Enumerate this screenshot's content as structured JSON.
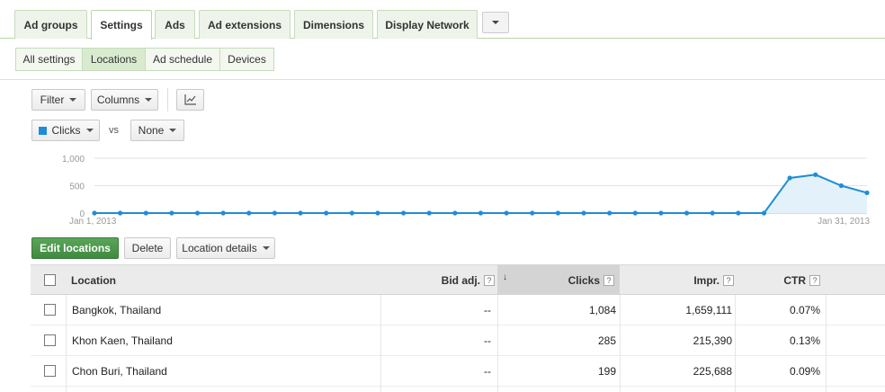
{
  "tabs": [
    {
      "label": "Ad groups",
      "active": false
    },
    {
      "label": "Settings",
      "active": true
    },
    {
      "label": "Ads",
      "active": false
    },
    {
      "label": "Ad extensions",
      "active": false
    },
    {
      "label": "Dimensions",
      "active": false
    },
    {
      "label": "Display Network",
      "active": false
    }
  ],
  "subtabs": [
    {
      "label": "All settings",
      "active": false
    },
    {
      "label": "Locations",
      "active": true
    },
    {
      "label": "Ad schedule",
      "active": false
    },
    {
      "label": "Devices",
      "active": false
    }
  ],
  "toolbar": {
    "filter_label": "Filter",
    "columns_label": "Columns",
    "chart_icon": "line-chart-icon"
  },
  "metrics": {
    "primary_label": "Clicks",
    "primary_color": "#1f8dd6",
    "vs_label": "vs",
    "secondary_label": "None"
  },
  "chart_data": {
    "type": "area",
    "x_start_label": "Jan 1, 2013",
    "x_end_label": "Jan 31, 2013",
    "y_ticks": [
      "1,000",
      "500",
      "0"
    ],
    "ylim": [
      0,
      1000
    ],
    "grid": true,
    "series": [
      {
        "color": "#1f8dd6",
        "values": [
          0,
          0,
          0,
          0,
          0,
          0,
          0,
          0,
          0,
          0,
          0,
          0,
          0,
          0,
          0,
          0,
          0,
          0,
          0,
          0,
          0,
          0,
          0,
          0,
          0,
          0,
          0,
          640,
          700,
          500,
          370
        ]
      }
    ]
  },
  "actions": {
    "edit_label": "Edit locations",
    "delete_label": "Delete",
    "details_label": "Location details"
  },
  "table": {
    "headers": {
      "location": "Location",
      "bid_adj": "Bid adj.",
      "clicks": "Clicks",
      "impr": "Impr.",
      "ctr": "CTR",
      "help": "?"
    },
    "rows": [
      {
        "location": "Bangkok, Thailand",
        "bid_adj": "--",
        "clicks": "1,084",
        "impr": "1,659,111",
        "ctr": "0.07%"
      },
      {
        "location": "Khon Kaen, Thailand",
        "bid_adj": "--",
        "clicks": "285",
        "impr": "215,390",
        "ctr": "0.13%"
      },
      {
        "location": "Chon Buri, Thailand",
        "bid_adj": "--",
        "clicks": "199",
        "impr": "225,688",
        "ctr": "0.09%"
      }
    ]
  }
}
